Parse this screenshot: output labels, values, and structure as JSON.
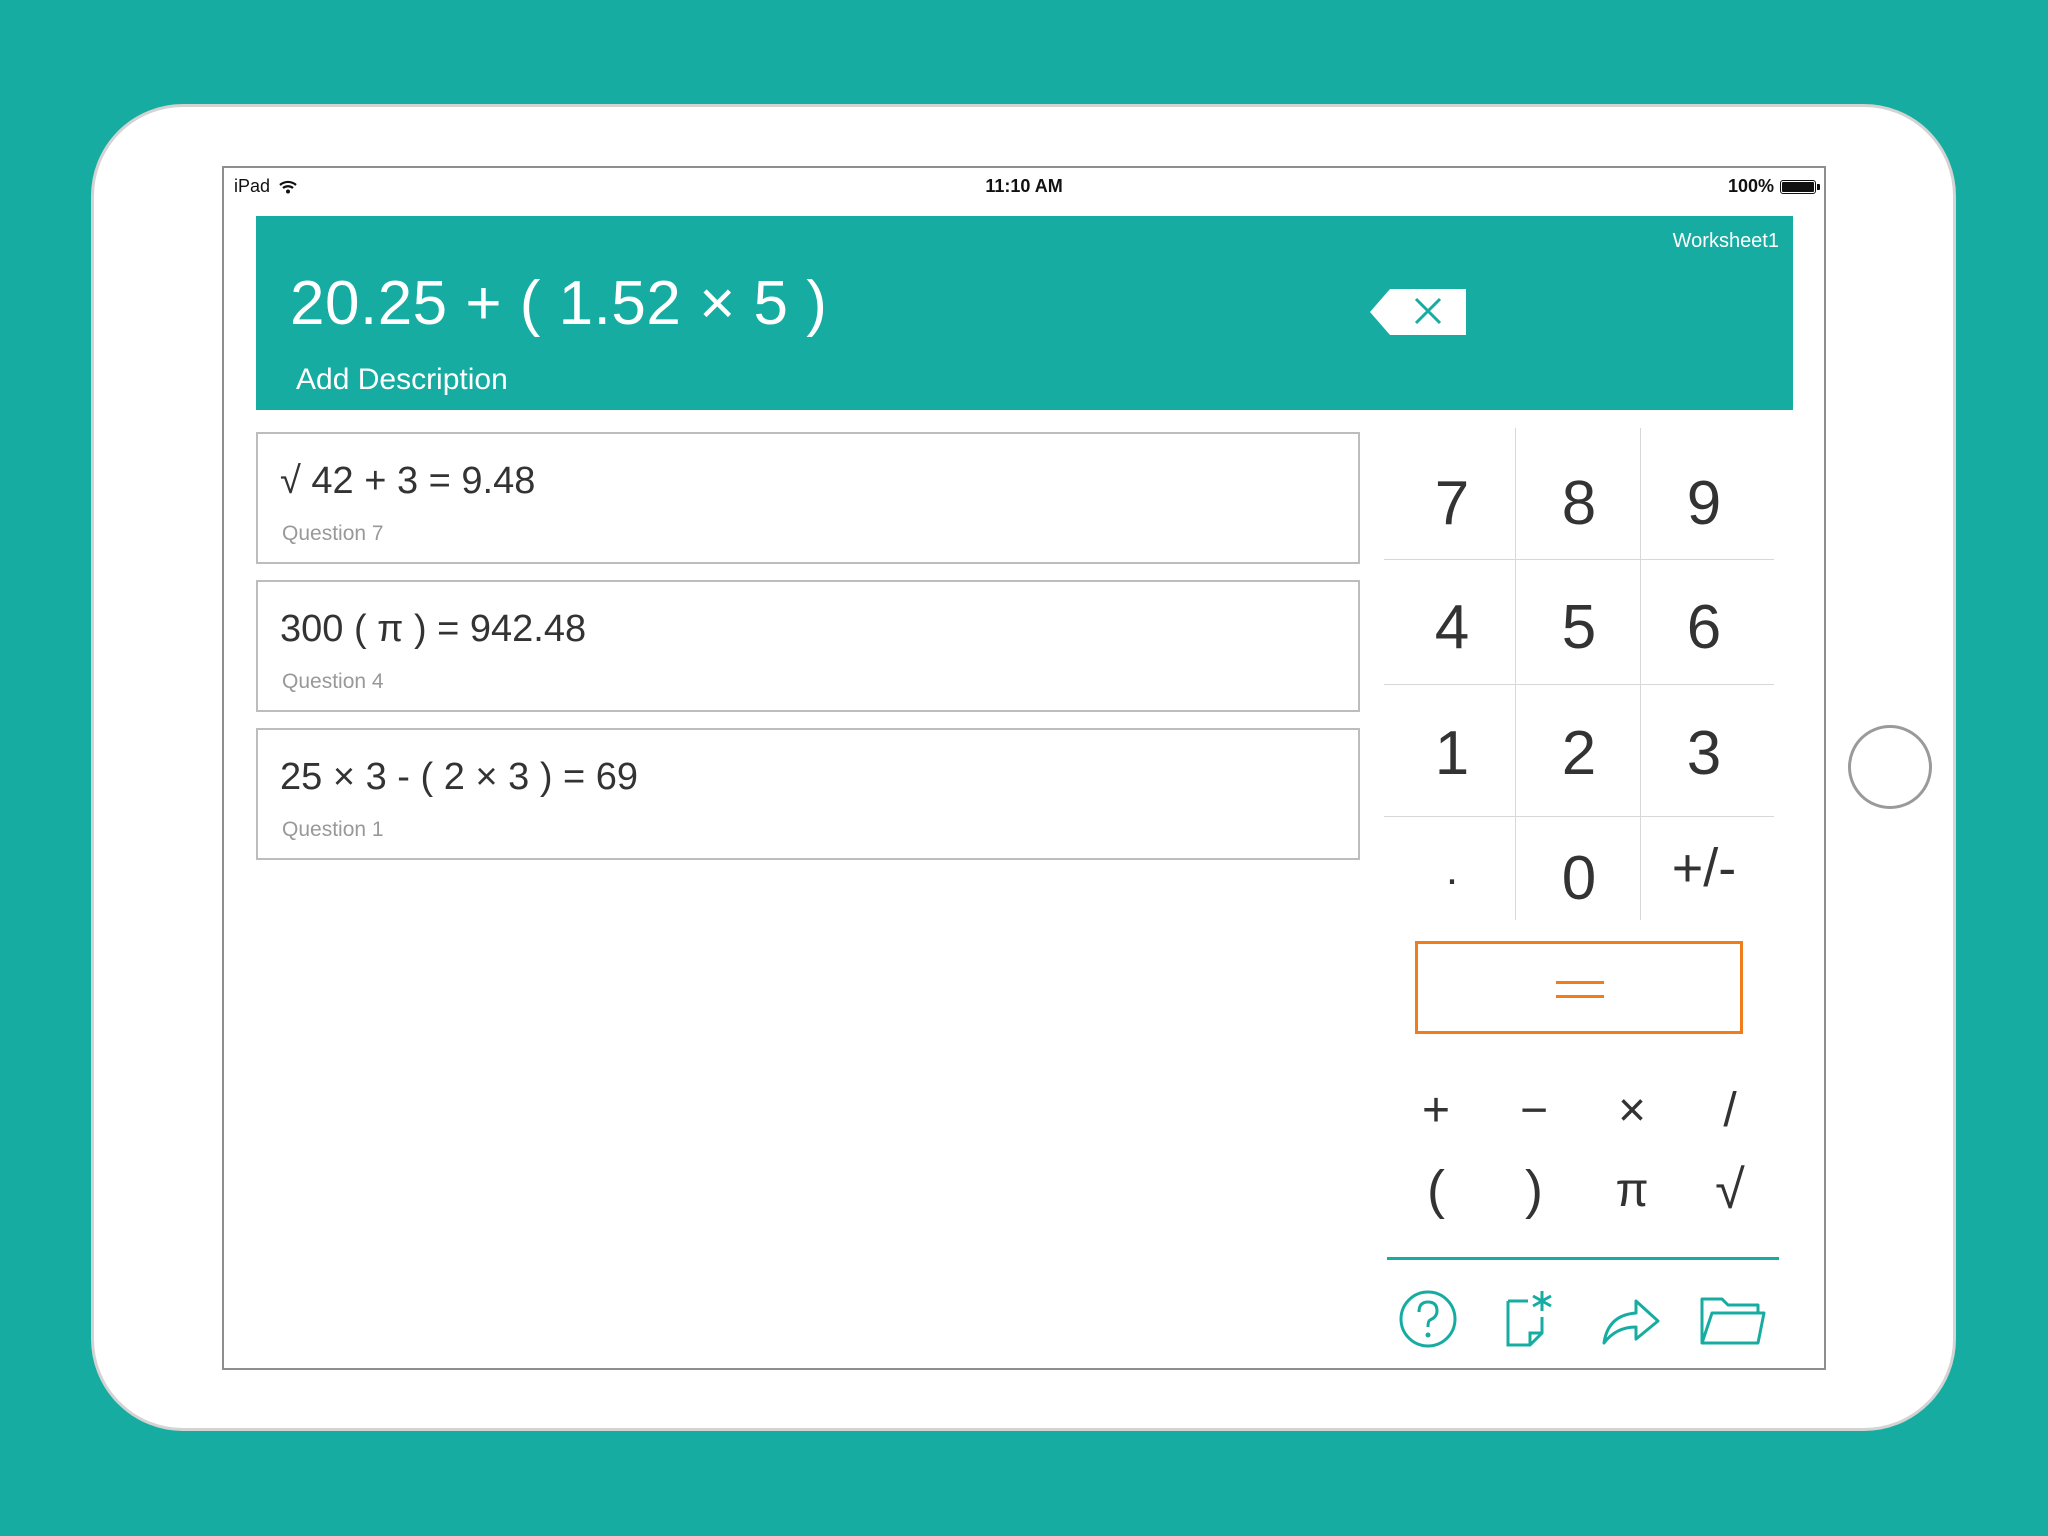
{
  "status_bar": {
    "device": "iPad",
    "time": "11:10 AM",
    "battery": "100%"
  },
  "header": {
    "worksheet_name": "Worksheet1",
    "expression": "20.25 + ( 1.52 × 5 )",
    "description_placeholder": "Add Description"
  },
  "history": [
    {
      "expression": "√ 42 + 3 = 9.48",
      "label": "Question 7"
    },
    {
      "expression": "300 ( π ) = 942.48",
      "label": "Question 4"
    },
    {
      "expression": "25 × 3 - ( 2 × 3 ) = 69",
      "label": "Question 1"
    }
  ],
  "keypad": {
    "rows": [
      [
        "7",
        "8",
        "9"
      ],
      [
        "4",
        "5",
        "6"
      ],
      [
        "1",
        "2",
        "3"
      ],
      [
        ".",
        "0",
        "+/-"
      ]
    ],
    "equals": "="
  },
  "operators": {
    "row1": [
      "+",
      "−",
      "×",
      "/"
    ],
    "row2": [
      "(",
      ")",
      "π",
      "√"
    ]
  },
  "toolbar": [
    "help-icon",
    "new-sheet-icon",
    "share-icon",
    "folder-icon"
  ],
  "colors": {
    "accent": "#17aca1",
    "equals": "#f07c1c",
    "text": "#333333"
  }
}
